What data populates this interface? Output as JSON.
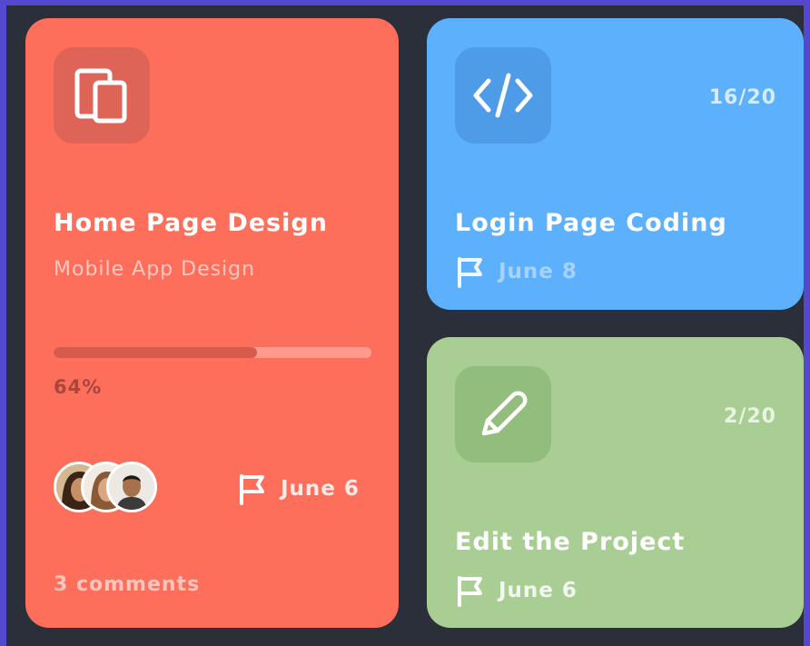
{
  "cards": [
    {
      "icon": "devices-icon",
      "title": "Home Page Design",
      "subtitle": "Mobile App Design",
      "progress": 0.64,
      "progress_label": "64%",
      "due": "June 6",
      "comments": "3 comments",
      "color": "#fd6e5b"
    },
    {
      "icon": "code-icon",
      "title": "Login Page Coding",
      "count": "16/20",
      "due": "June 8",
      "color": "#5db0fb"
    },
    {
      "icon": "pencil-icon",
      "title": "Edit the Project",
      "count": "2/20",
      "due": "June 6",
      "color": "#a9ce93"
    }
  ],
  "colors": {
    "background": "#2b2f3a",
    "frame": "#5548d0"
  }
}
